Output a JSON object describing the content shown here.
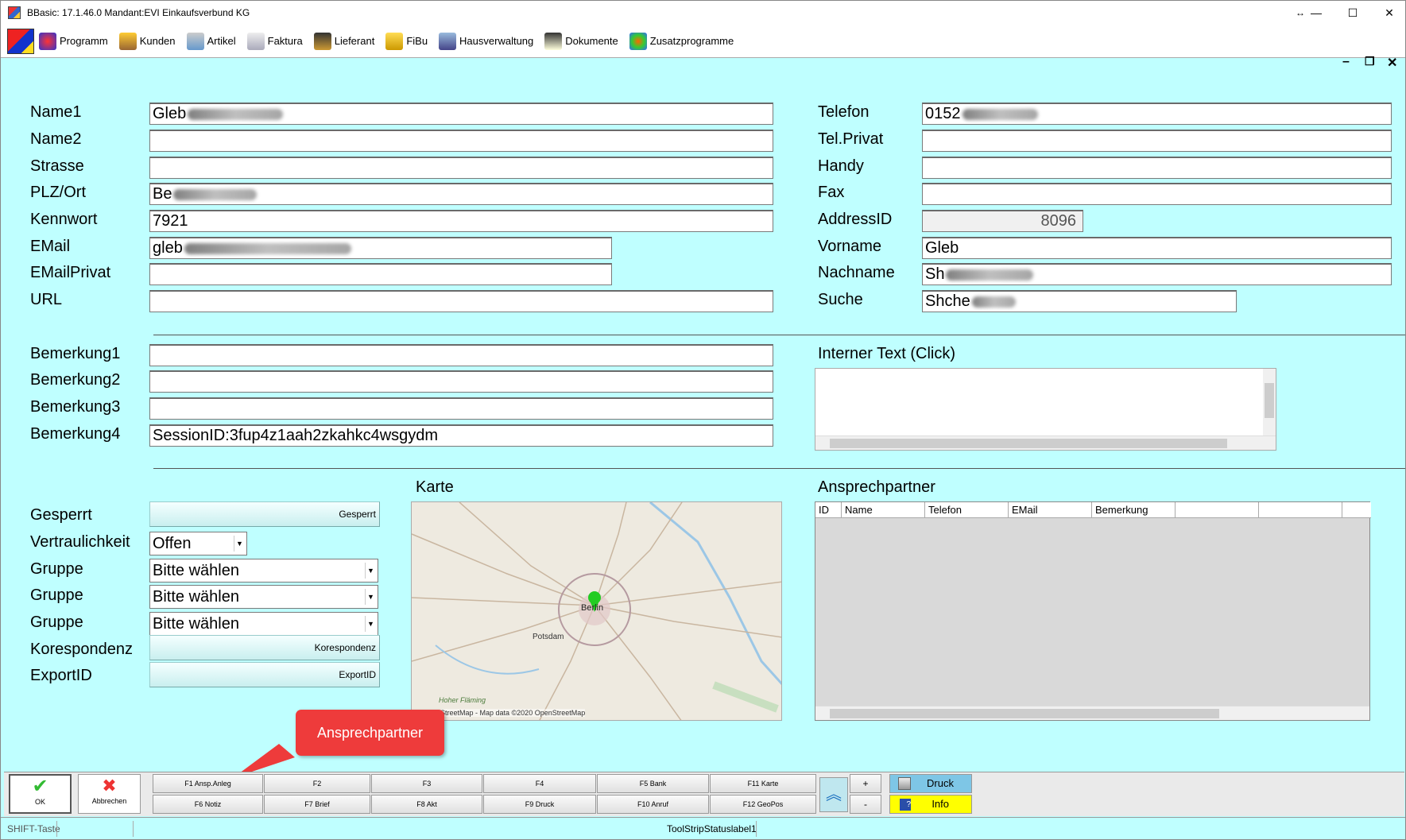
{
  "window": {
    "title": "BBasic: 17.1.46.0 Mandant:EVI Einkaufsverbund KG"
  },
  "menu": [
    "Programm",
    "Kunden",
    "Artikel",
    "Faktura",
    "Lieferant",
    "FiBu",
    "Hausverwaltung",
    "Dokumente",
    "Zusatzprogramme"
  ],
  "left": {
    "name1": {
      "label": "Name1",
      "value": "Gleb Shchepetnov"
    },
    "name2": {
      "label": "Name2",
      "value": ""
    },
    "strasse": {
      "label": "Strasse",
      "value": ""
    },
    "plz": {
      "label": "PLZ/Ort",
      "value": "Berlin 10000"
    },
    "kennwort": {
      "label": "Kennwort",
      "value": "7921"
    },
    "email": {
      "label": "EMail",
      "value": "gleb.shchepetnov@gmail.com"
    },
    "emailprivat": {
      "label": "EMailPrivat",
      "value": ""
    },
    "url": {
      "label": "URL",
      "value": ""
    }
  },
  "right": {
    "telefon": {
      "label": "Telefon",
      "value": "015255074285"
    },
    "telprivat": {
      "label": "Tel.Privat",
      "value": ""
    },
    "handy": {
      "label": "Handy",
      "value": ""
    },
    "fax": {
      "label": "Fax",
      "value": ""
    },
    "addressid": {
      "label": "AddressID",
      "value": "8096"
    },
    "vorname": {
      "label": "Vorname",
      "value": "Gleb"
    },
    "nachname": {
      "label": "Nachname",
      "value": "Shchepetnov"
    },
    "suche": {
      "label": "Suche",
      "value": "Shchepetnov"
    }
  },
  "bemerkungen": [
    {
      "label": "Bemerkung1",
      "value": ""
    },
    {
      "label": "Bemerkung2",
      "value": ""
    },
    {
      "label": "Bemerkung3",
      "value": ""
    },
    {
      "label": "Bemerkung4",
      "value": "SessionID:3fup4z1aah2zkahkc4wsgydm"
    }
  ],
  "interner_text": {
    "label": "Interner Text (Click)"
  },
  "bottom": {
    "gesperrt": {
      "label": "Gesperrt",
      "button": "Gesperrt"
    },
    "vertraulichkeit": {
      "label": "Vertraulichkeit",
      "value": "Offen"
    },
    "gruppe_label": "Gruppe",
    "gruppe_value": "Bitte wählen",
    "korespondenz": {
      "label": "Korespondenz",
      "button": "Korespondenz"
    },
    "exportid": {
      "label": "ExportID",
      "button": "ExportID"
    }
  },
  "karte": {
    "label": "Karte",
    "city": "Berlin",
    "town": "Potsdam",
    "area": "Hoher Fläming",
    "credit": "StreetMap - Map data ©2020 OpenStreetMap"
  },
  "ansprechpartner": {
    "label": "Ansprechpartner",
    "columns": [
      "ID",
      "Name",
      "Telefon",
      "EMail",
      "Bemerkung"
    ]
  },
  "callout": "Ansprechpartner",
  "toolbar": {
    "ok": "OK",
    "abbrechen": "Abbrechen",
    "top": [
      "F1 Ansp.Anleg",
      "F2",
      "F3",
      "F4",
      "F5 Bank",
      "F11 Karte"
    ],
    "bottom": [
      "F6 Notiz",
      "F7 Brief",
      "F8 Akt",
      "F9 Druck",
      "F10 Anruf",
      "F12 GeoPos"
    ],
    "plus": "+",
    "minus": "-",
    "druck": "Druck",
    "info": "Info"
  },
  "status": {
    "shift": "SHIFT-Taste",
    "label": "ToolStripStatuslabel1"
  }
}
